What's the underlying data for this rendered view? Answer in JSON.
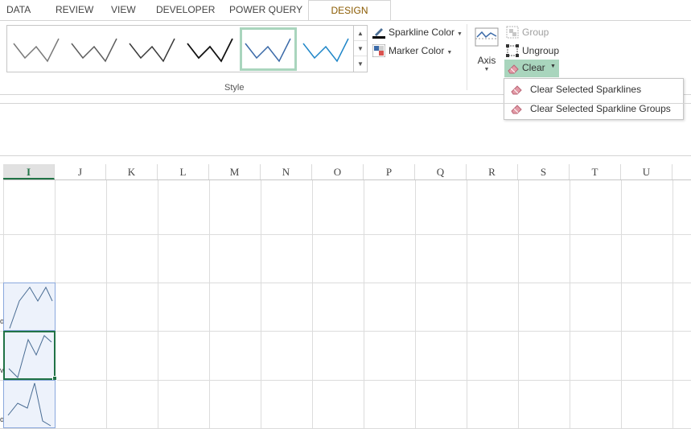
{
  "tabs": [
    "DATA",
    "REVIEW",
    "VIEW",
    "DEVELOPER",
    "POWER QUERY",
    "DESIGN"
  ],
  "active_tab": "DESIGN",
  "style_group": {
    "label": "Style",
    "selected_index": 4,
    "thumb_colors": [
      "#7a7a7a",
      "#5e5e5e",
      "#3a3a3a",
      "#111111",
      "#3b6aa8",
      "#1f86c8"
    ]
  },
  "buttons": {
    "sparkline_color": "Sparkline Color",
    "marker_color": "Marker Color",
    "axis": "Axis",
    "group": "Group",
    "ungroup": "Ungroup",
    "clear": "Clear"
  },
  "clear_menu": {
    "items": [
      "Clear Selected Sparklines",
      "Clear Selected Sparkline Groups"
    ]
  },
  "columns": [
    "I",
    "J",
    "K",
    "L",
    "M",
    "N",
    "O",
    "P",
    "Q",
    "R",
    "S",
    "T",
    "U"
  ],
  "active_column": "I",
  "row_edge_marks": [
    "o",
    "v",
    "o"
  ],
  "colors": {
    "accent_green": "#217346",
    "clear_highlight": "#a9d5bd",
    "sparkline": "#4a6d94"
  }
}
